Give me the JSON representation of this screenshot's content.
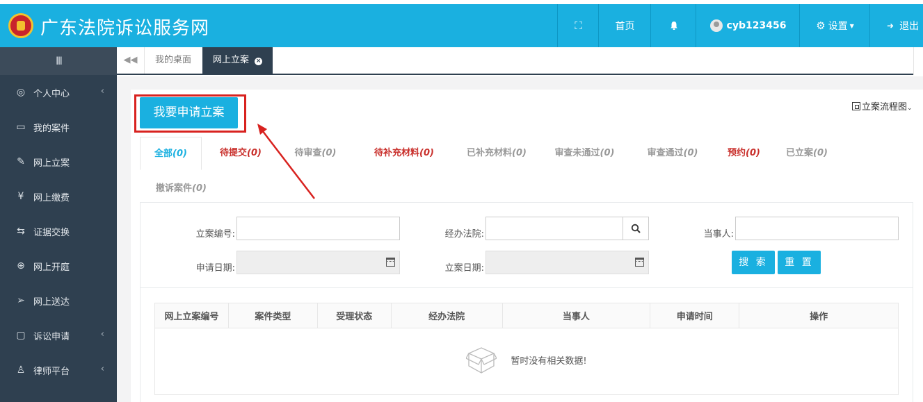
{
  "header": {
    "site_title": "广东法院诉讼服务网",
    "home_label": "首页",
    "username": "cyb123456",
    "settings_label": "设置",
    "logout_label": "退出"
  },
  "sidebar": {
    "toggle_glyph": "III",
    "items": [
      {
        "label": "个人中心",
        "icon": "user-circle-icon",
        "has_arrow": true
      },
      {
        "label": "我的案件",
        "icon": "document-icon",
        "has_arrow": false
      },
      {
        "label": "网上立案",
        "icon": "edit-icon",
        "has_arrow": false
      },
      {
        "label": "网上缴费",
        "icon": "yen-circle-icon",
        "has_arrow": false
      },
      {
        "label": "证据交换",
        "icon": "exchange-icon",
        "has_arrow": false
      },
      {
        "label": "网上开庭",
        "icon": "globe-icon",
        "has_arrow": false
      },
      {
        "label": "网上送达",
        "icon": "send-icon",
        "has_arrow": false
      },
      {
        "label": "诉讼申请",
        "icon": "form-icon",
        "has_arrow": true
      },
      {
        "label": "律师平台",
        "icon": "person-icon",
        "has_arrow": true
      }
    ]
  },
  "tabs": {
    "desk": "我的桌面",
    "active": "网上立案"
  },
  "main": {
    "apply_button": "我要申请立案",
    "flow_link": "立案流程图",
    "status_tabs": [
      {
        "label": "全部",
        "count": "(0)"
      },
      {
        "label": "待提交",
        "count": "(0)"
      },
      {
        "label": "待审查",
        "count": "(0)"
      },
      {
        "label": "待补充材料",
        "count": "(0)"
      },
      {
        "label": "已补充材料",
        "count": "(0)"
      },
      {
        "label": "审查未通过",
        "count": "(0)"
      },
      {
        "label": "审查通过",
        "count": "(0)"
      },
      {
        "label": "预约",
        "count": "(0)"
      },
      {
        "label": "已立案",
        "count": "(0)"
      },
      {
        "label": "撤诉案件",
        "count": "(0)"
      }
    ],
    "form": {
      "case_no_label": "立案编号:",
      "court_label": "经办法院:",
      "party_label": "当事人:",
      "apply_date_label": "申请日期:",
      "file_date_label": "立案日期:",
      "search_button": "搜 索",
      "reset_button": "重 置"
    },
    "table": {
      "columns": [
        "网上立案编号",
        "案件类型",
        "受理状态",
        "经办法院",
        "当事人",
        "申请时间",
        "操作"
      ],
      "empty_text": "暂时没有相关数据!"
    }
  },
  "colors": {
    "header_bg": "#1ab0e0",
    "sidebar_bg": "#2f4050",
    "accent": "#1ab0e0",
    "highlight_red": "#d8221f"
  }
}
